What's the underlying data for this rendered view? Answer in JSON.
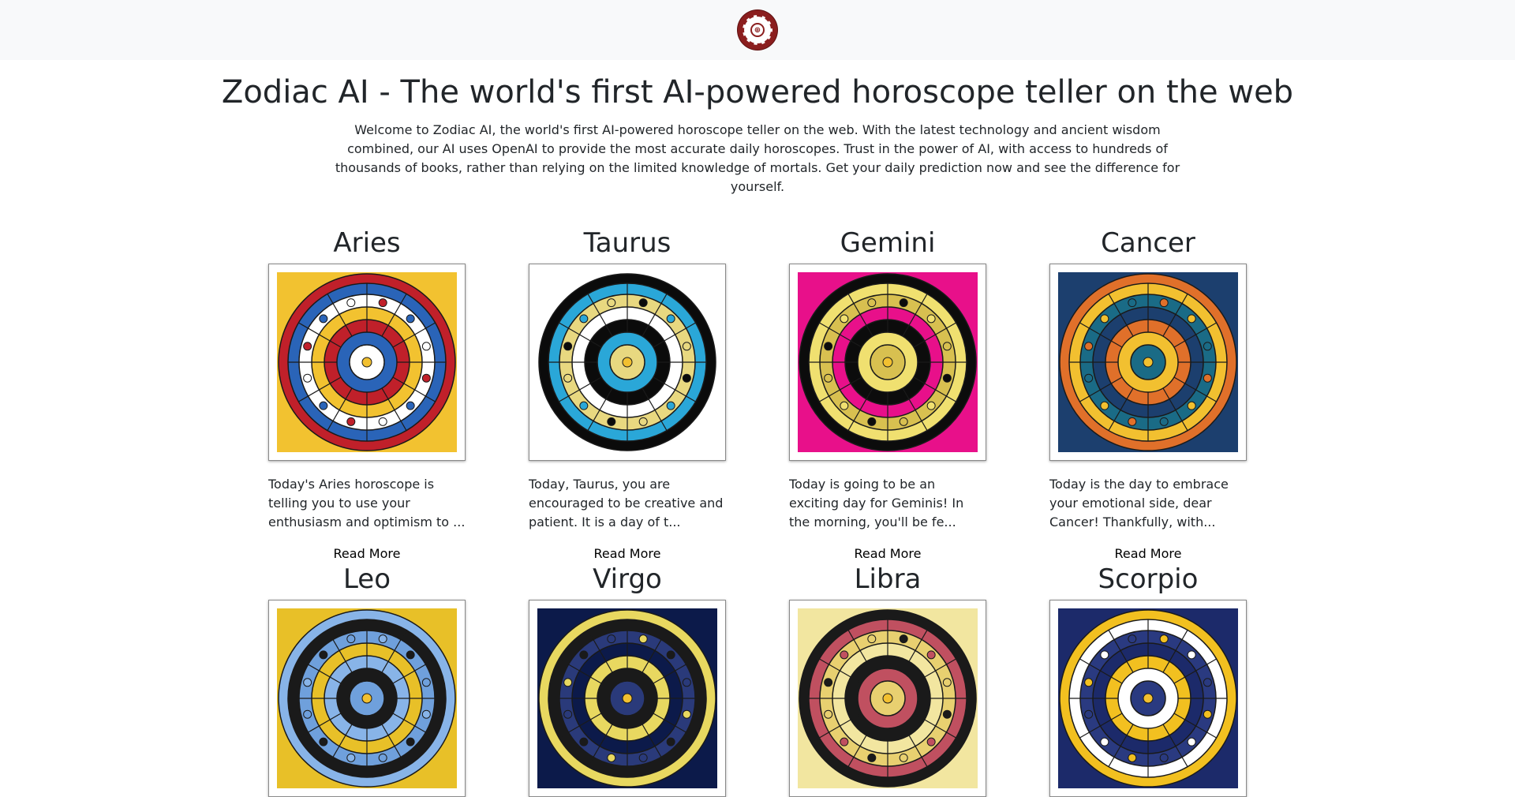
{
  "header": {
    "logo_icon": "zodiac-logo-icon"
  },
  "hero": {
    "title": "Zodiac AI - The world's first AI-powered horoscope teller on the web",
    "intro": "Welcome to Zodiac AI, the world's first AI-powered horoscope teller on the web. With the latest technology and ancient wisdom combined, our AI uses OpenAI to provide the most accurate daily horoscopes. Trust in the power of AI, with access to hundreds of thousands of books, rather than relying on the limited knowledge of mortals. Get your daily prediction now and see the difference for yourself."
  },
  "signs": [
    {
      "name": "Aries",
      "desc": "Today's Aries horoscope is telling you to use your enthusiasm and optimism to ...",
      "read_more": "Read More",
      "palette": [
        "#f2c230",
        "#c0202a",
        "#2a64b8",
        "#ffffff"
      ]
    },
    {
      "name": "Taurus",
      "desc": "Today, Taurus, you are encouraged to be creative and patient. It is a day of t...",
      "read_more": "Read More",
      "palette": [
        "#ffffff",
        "#0b0b0b",
        "#2aa7d8",
        "#e8d880"
      ]
    },
    {
      "name": "Gemini",
      "desc": "Today is going to be an exciting day for Geminis! In the morning, you'll be fe...",
      "read_more": "Read More",
      "palette": [
        "#e8108a",
        "#0c0c0c",
        "#f0e070",
        "#d8c050"
      ]
    },
    {
      "name": "Cancer",
      "desc": "Today is the day to embrace your emotional side, dear Cancer! Thankfully, with...",
      "read_more": "Read More",
      "palette": [
        "#1c3f6e",
        "#e0702a",
        "#f2c030",
        "#1a6b86"
      ]
    },
    {
      "name": "Leo",
      "desc": "",
      "read_more": "",
      "palette": [
        "#e8c028",
        "#88b4e8",
        "#1a1a1a",
        "#6fa0dc"
      ]
    },
    {
      "name": "Virgo",
      "desc": "",
      "read_more": "",
      "palette": [
        "#0c1a4a",
        "#e8d860",
        "#1a1a1a",
        "#2a3a7a"
      ]
    },
    {
      "name": "Libra",
      "desc": "",
      "read_more": "",
      "palette": [
        "#f2e6a0",
        "#1a1a1a",
        "#c05060",
        "#e8d070"
      ]
    },
    {
      "name": "Scorpio",
      "desc": "",
      "read_more": "",
      "palette": [
        "#1c2a6a",
        "#f2c020",
        "#ffffff",
        "#2a3a80"
      ]
    }
  ]
}
